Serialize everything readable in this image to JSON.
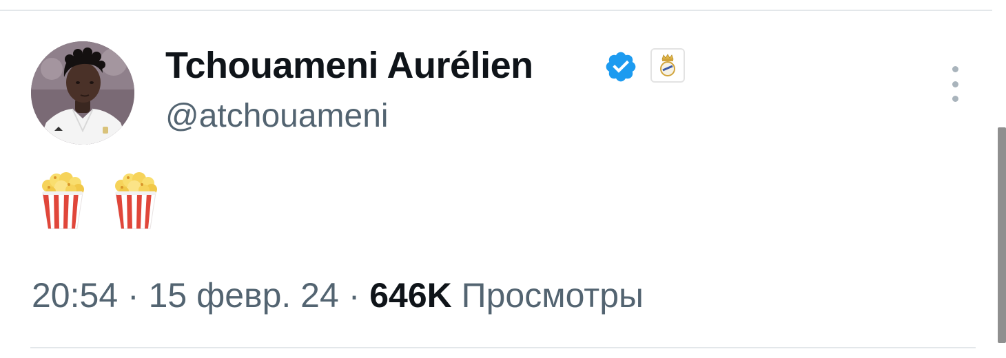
{
  "tweet": {
    "display_name": "Tchouameni Aurélien",
    "handle": "@atchouameni",
    "content_emojis": [
      "popcorn-emoji",
      "popcorn-emoji"
    ],
    "time": "20:54",
    "separator_1": " · ",
    "date": "15 февр. 24",
    "separator_2": " · ",
    "views_count": "646K",
    "views_label": "Просмотры"
  },
  "icons": {
    "verified": "verified-badge-icon",
    "club": "club-crest-icon",
    "more": "more-vertical-icon"
  },
  "colors": {
    "verified_blue": "#1d9bf0",
    "text_primary": "#0f1419",
    "text_secondary": "#536471"
  }
}
